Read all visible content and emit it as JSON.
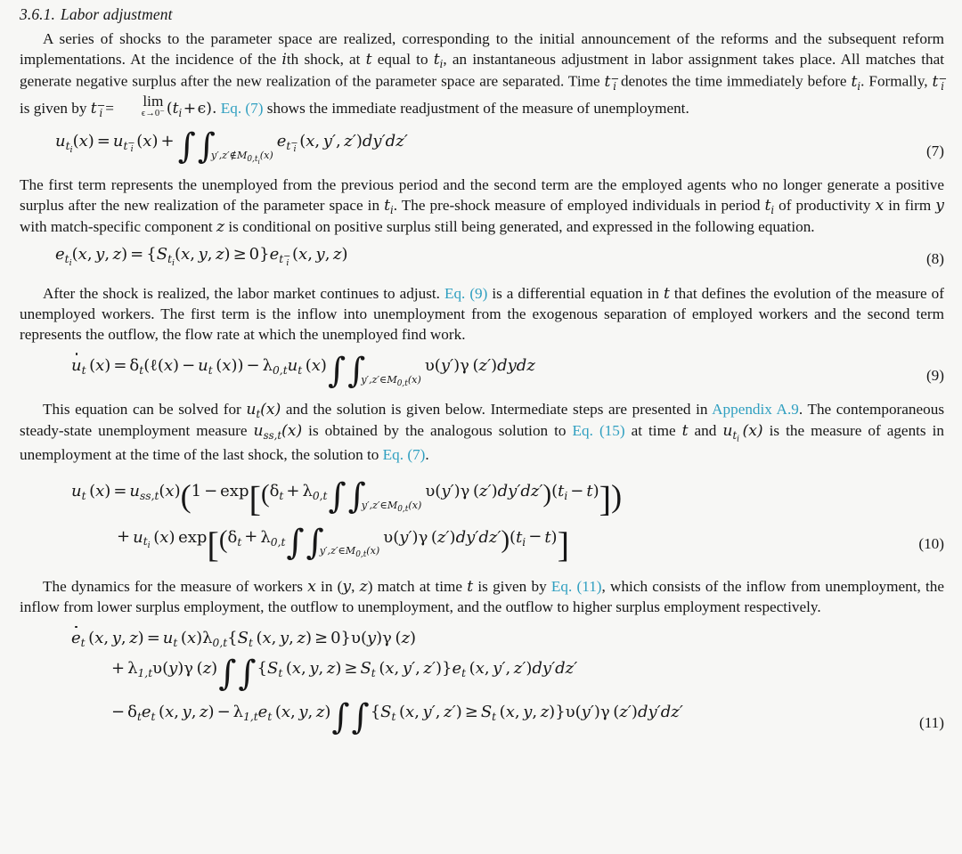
{
  "document": {
    "background_color": "#f7f7f5",
    "text_color": "#171717",
    "link_color": "#2f9fc0"
  },
  "section": {
    "number": "3.6.1.",
    "title": "Labor adjustment"
  },
  "paragraphs": {
    "p1": {
      "seg1": "A series of shocks to the parameter space are realized, corresponding to the initial announcement of the reforms and the subsequent reform implementations. At the incidence of the ",
      "ith": "i",
      "seg2": "th shock, at ",
      "t_sym": "t",
      "seg3": " equal to ",
      "ti_sym": "t",
      "ti_sub": "i",
      "seg4": ", an instantaneous adjustment in labor assignment takes place. All matches that generate negative surplus after the new realization of the parameter space are separated. Time ",
      "seg5": " denotes the time immediately before ",
      "seg6": ". Formally, ",
      "seg7": " is given by ",
      "eq_equals": "=",
      "lim_label": "lim",
      "lim_sub": "ϵ→0⁻",
      "lim_arg_open": "(",
      "lim_arg": "t",
      "lim_arg_sub": "i",
      "lim_plus": "+",
      "lim_eps": "ϵ",
      "lim_arg_close": ").",
      "link_eq7": "Eq. (7)",
      "seg8": " shows the immediate readjustment of the measure of unemployment."
    },
    "p2": {
      "seg1": "The first term represents the unemployed from the previous period and the second term are the employed agents who no longer generate a positive surplus after the new realization of the parameter space in ",
      "seg2": ". The pre-shock measure of employed individuals in period ",
      "seg3": " of productivity ",
      "x": "x",
      "seg4": " in firm ",
      "y": "y",
      "seg5": " with match-specific component ",
      "z": "z",
      "seg6": " is conditional on positive surplus still being generated, and expressed in the following equation."
    },
    "p3": {
      "seg1": "After the shock is realized, the labor market continues to adjust. ",
      "link_eq9": "Eq. (9)",
      "seg2": " is a differential equation in ",
      "t": "t",
      "seg3": " that defines the evolution of the measure of unemployed workers. The first term is the inflow into unemployment from the exogenous separation of employed workers and the second term represents the outflow, the flow rate at which the unemployed find work."
    },
    "p4": {
      "seg1": "This equation can be solved for ",
      "seg2": " and the solution is given below. Intermediate steps are presented in ",
      "link_appendix": "Appendix A.9",
      "seg3": ". The contemporaneous steady-state unemployment measure ",
      "seg4": " is obtained by the analogous solution to ",
      "link_eq15": "Eq. (15)",
      "seg5": " at time ",
      "t": "t",
      "seg6": " and ",
      "seg7": " is the measure of agents in unemployment at the time of the last shock, the solution to ",
      "link_eq7": "Eq. (7)",
      "seg8": "."
    },
    "p5": {
      "seg1": "The dynamics for the measure of workers ",
      "x": "x",
      "seg2": " in (",
      "y": "y",
      "seg2b": ", ",
      "z": "z",
      "seg3": ") match at time ",
      "t": "t",
      "seg4": " is given by ",
      "link_eq11": "Eq. (11)",
      "seg5": ", which consists of the inflow from unemployment, the inflow from lower surplus employment, the outflow to unemployment, and the outflow to higher surplus employment respectively."
    }
  },
  "equations": {
    "eq7": {
      "number": "(7)",
      "latex": "u_{t_i}(x) = u_{t_i^-}(x) + \\int\\int_{y',z'\\notin \\mathcal{M}_{0,t_i}(x)} e_{t_i^-}(x,y',z')dy'dz'",
      "tokens": {
        "u": "u",
        "t": "t",
        "i": "i",
        "minus": "−",
        "open": "(",
        "x": "x",
        "close": ")",
        "equals": "=",
        "plus": "+",
        "intsign": "∫",
        "limit": "y′,z′∉",
        "calM": "M",
        "calM_sub": "0,t",
        "e": "e",
        "args": "(x, y′, z′)",
        "diff": "dy′dz′"
      }
    },
    "eq8": {
      "number": "(8)",
      "latex": "e_{t_i}(x,y,z) = \\{S_{t_i}(x,y,z) \\geq 0\\}e_{t_i^-}(x,y,z)",
      "tokens": {
        "e": "e",
        "S": "S",
        "geq": "≥",
        "zero": "0",
        "args": "(x, y, z)",
        "brace_open": "{",
        "brace_close": "}"
      }
    },
    "eq9": {
      "number": "(9)",
      "latex": "\\dot{u}_t(x) = \\delta_t(\\ell(x) - u_t(x)) - \\lambda_{0,t}u_t(x)\\int\\int_{y',z'\\in\\mathcal{M}_{0,t}(x)} \\upsilon(y')\\gamma(z')dydz",
      "tokens": {
        "u": "u",
        "delta": "δ",
        "ell": "ℓ",
        "lambda": "λ",
        "lambda_sub": "0,t",
        "upsilon": "υ",
        "gamma": "γ",
        "diff": "dydz",
        "minus": "−",
        "in": "∈"
      }
    },
    "eq10": {
      "number": "(10)",
      "latex": "u_t(x) = u_{ss,t}(x)\\left(1 - \\exp\\left[\\left(\\delta_t + \\lambda_{0,t}\\int\\int_{y',z'\\in\\mathcal{M}_{0,t}(x)}\\upsilon(y')\\gamma(z')dy'dz'\\right)(t_i - t)\\right]\\right) + u_{t_i}(x)\\exp\\left[\\left(\\delta_t + \\lambda_{0,t}\\int\\int_{y',z'\\in\\mathcal{M}_{0,t}(x)}\\upsilon(y')\\gamma(z')dy'dz'\\right)(t_i - t)\\right]",
      "tokens": {
        "u_ss": "u",
        "ss_sub": "ss,t",
        "one": "1",
        "exp": "exp",
        "ti_minus_t": "(t",
        "ti_sub": "i",
        "minus_t": " − t)"
      }
    },
    "eq11": {
      "number": "(11)",
      "latex": "\\dot{e}_t(x,y,z) = u_t(x)\\lambda_{0,t}\\{S_t(x,y,z)\\geq 0\\}\\upsilon(y)\\gamma(z) + \\lambda_{1,t}\\upsilon(y)\\gamma(z)\\int\\int\\{S_t(x,y,z)\\geq S_t(x,y',z')\\}e_t(x,y',z')dy'dz' - \\delta_t e_t(x,y,z) - \\lambda_{1,t}e_t(x,y,z)\\int\\int\\{S_t(x,y',z')\\geq S_t(x,y,z)\\}\\upsilon(y')\\gamma(z')dy'dz'",
      "tokens": {
        "lambda1": "λ",
        "lambda1_sub": "1,t",
        "e": "e",
        "S": "S"
      }
    }
  }
}
